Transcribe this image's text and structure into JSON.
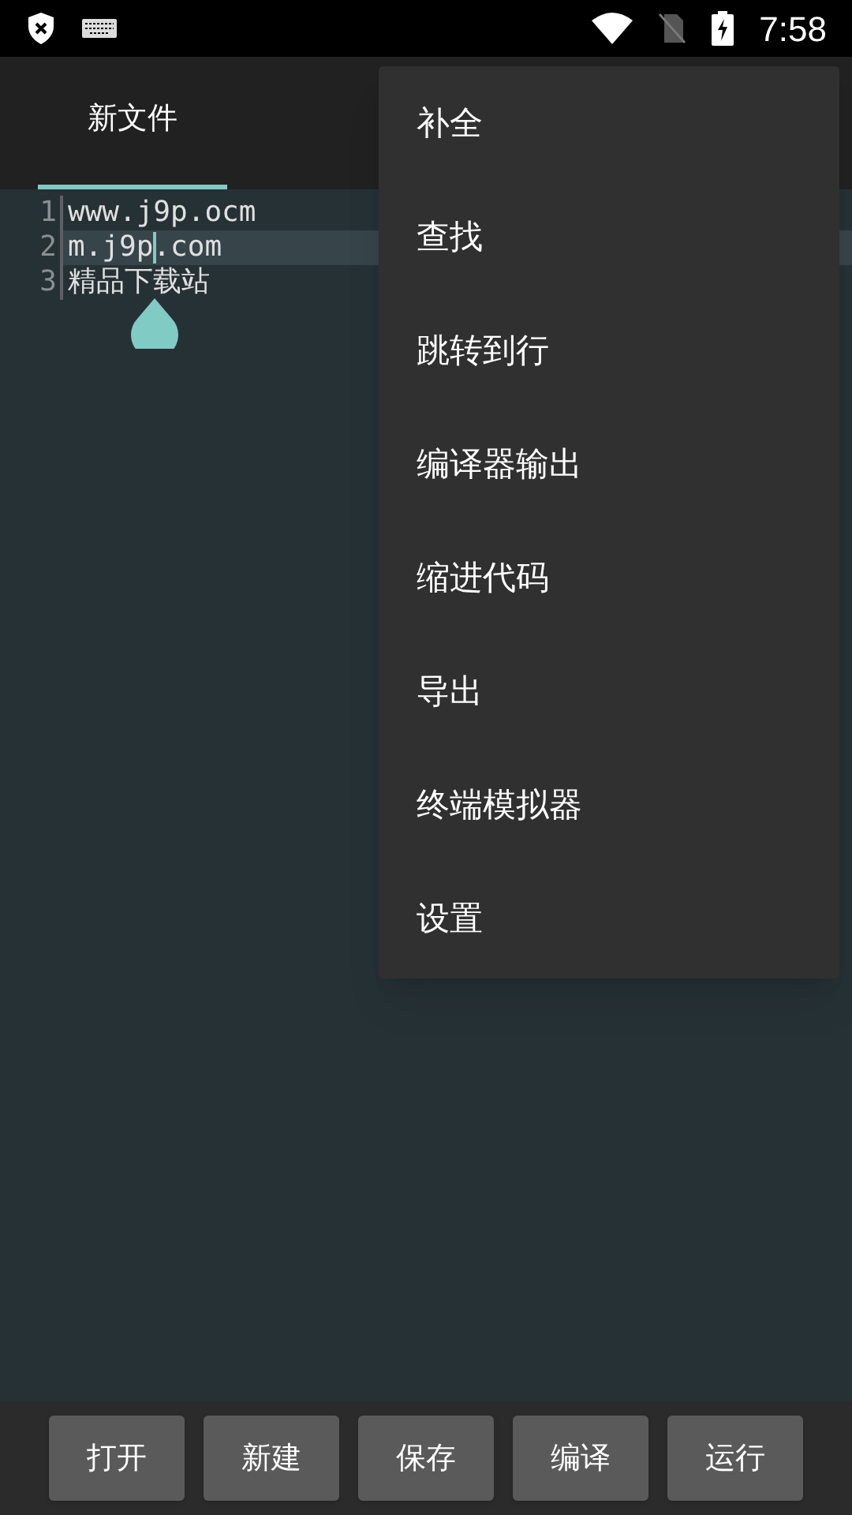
{
  "status_bar": {
    "time": "7:58"
  },
  "tabs": [
    {
      "label": "新文件",
      "selected": true
    }
  ],
  "editor": {
    "lines": [
      {
        "number": "1",
        "text": "www.j9p.ocm",
        "current": false
      },
      {
        "number": "2",
        "text": "m.j9p.com",
        "current": true
      },
      {
        "number": "3",
        "text": "精品下载站",
        "current": false
      }
    ]
  },
  "menu": {
    "items": [
      "补全",
      "查找",
      "跳转到行",
      "编译器输出",
      "缩进代码",
      "导出",
      "终端模拟器",
      "设置"
    ]
  },
  "buttons": [
    "打开",
    "新建",
    "保存",
    "编译",
    "运行"
  ]
}
